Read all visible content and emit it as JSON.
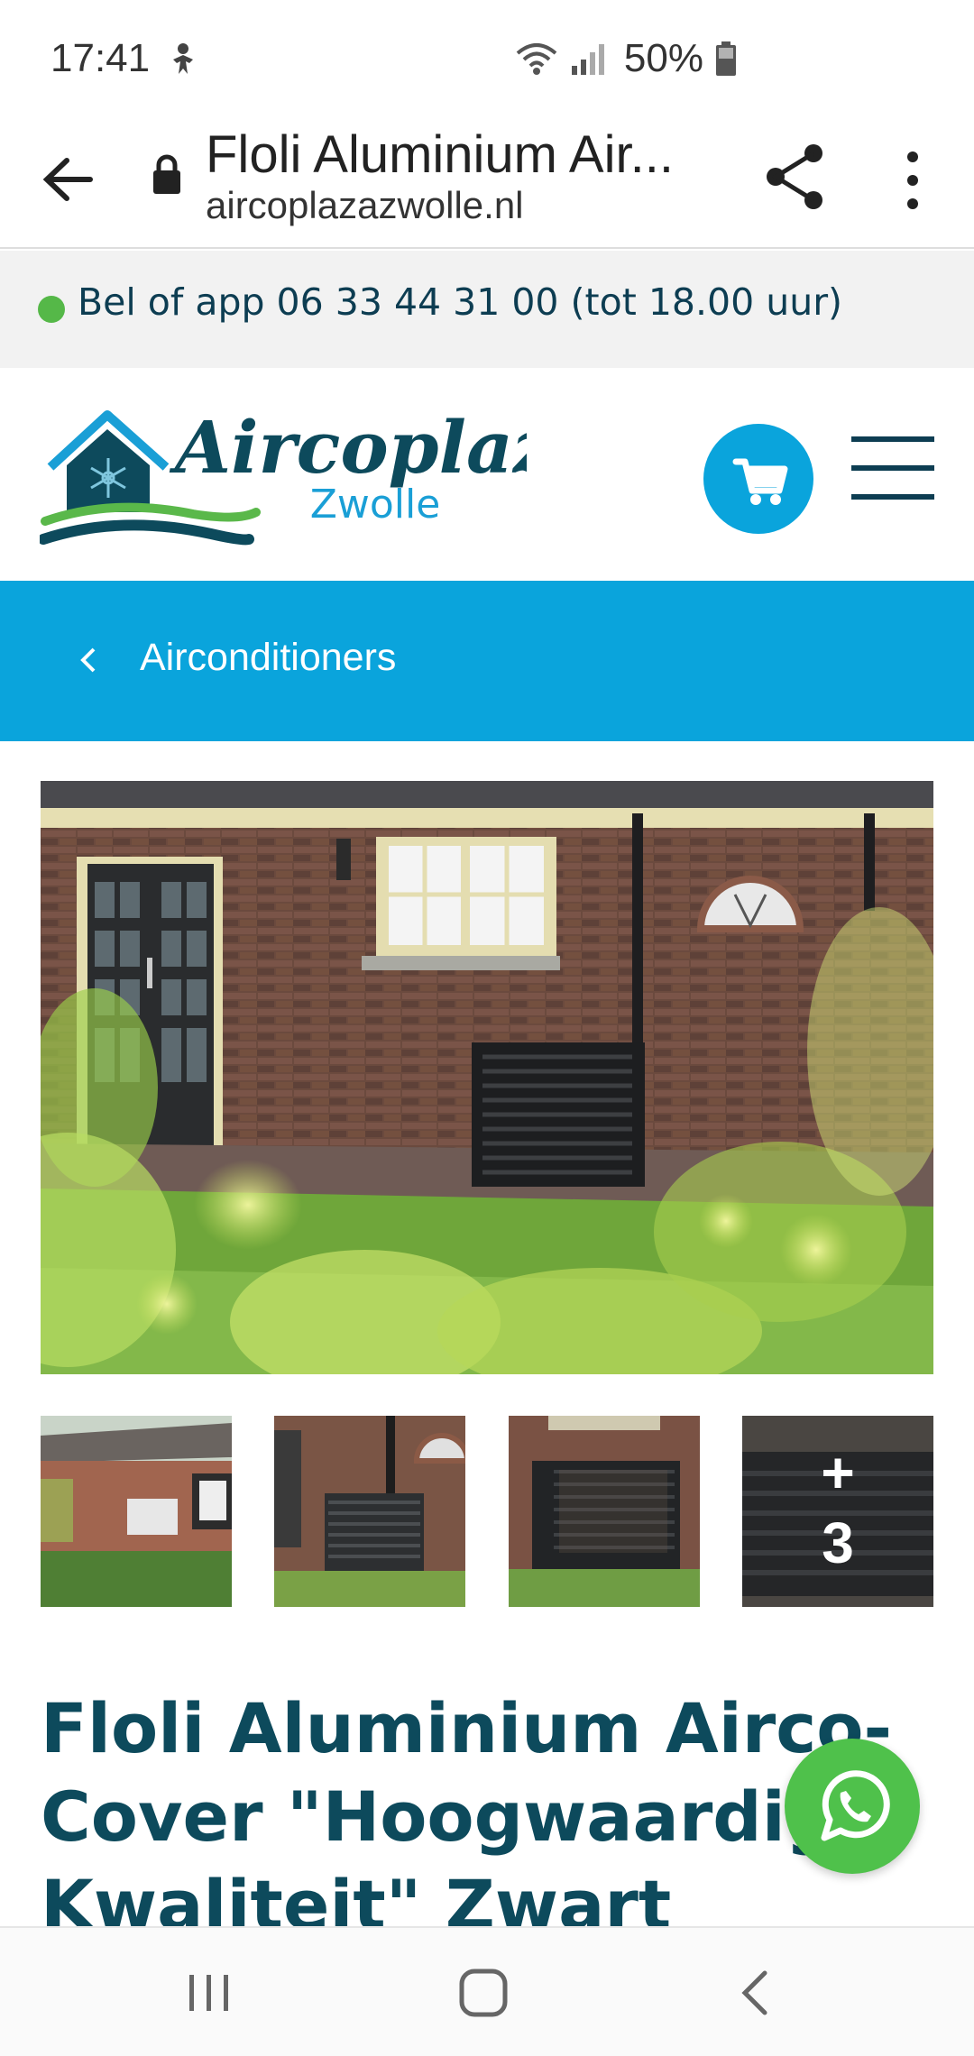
{
  "status_bar": {
    "time": "17:41",
    "battery": "50%"
  },
  "browser": {
    "page_title": "Floli Aluminium Air...",
    "domain": "aircoplazazwolle.nl"
  },
  "call_bar": {
    "text": "Bel of app 06 33 44 31 00 (tot 18.00 uur)"
  },
  "logo": {
    "name": "Aircoplaza",
    "city": "Zwolle"
  },
  "breadcrumb": {
    "label": "Airconditioners"
  },
  "gallery": {
    "more_plus": "+",
    "more_count": "3"
  },
  "product": {
    "title": "Floli Aluminium Airco-Cover \"Hoogwaardige Kwaliteit\" Zwart"
  },
  "colors": {
    "brand_blue": "#0aa4dc",
    "brand_dark": "#0d4a5c",
    "whatsapp_green": "#4fc14b",
    "status_dot": "#55b848"
  }
}
